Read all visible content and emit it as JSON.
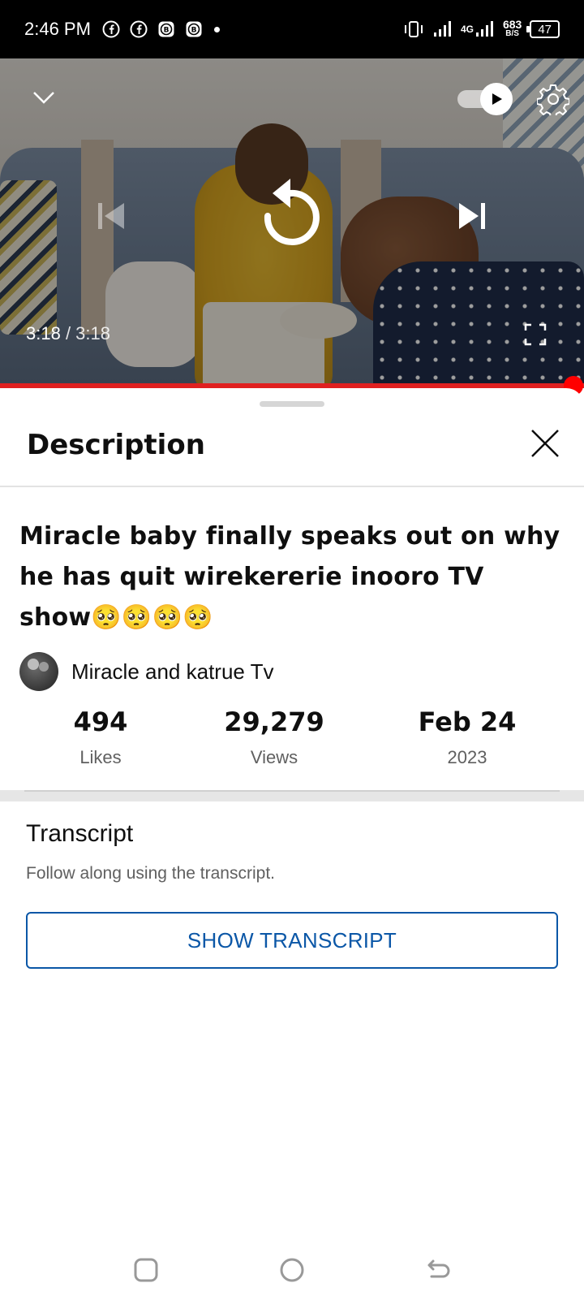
{
  "status_bar": {
    "time": "2:46 PM",
    "network_type": "4G",
    "net_speed_value": "683",
    "net_speed_unit": "B/S",
    "battery": "47",
    "app_icons": [
      "facebook-icon",
      "facebook-icon",
      "bitcoin-icon",
      "bitcoin-icon"
    ]
  },
  "player": {
    "current_time": "3:18",
    "separator": " / ",
    "total_time": "3:18",
    "progress": 1.0
  },
  "description": {
    "header_title": "Description",
    "video_title": "Miracle baby finally speaks out on why he has quit wirekererie inooro TV show🥺🥺🥺🥺",
    "channel_name": "Miracle and katrue Tv",
    "stats": {
      "likes_value": "494",
      "likes_label": "Likes",
      "views_value": "29,279",
      "views_label": "Views",
      "date_value": "Feb 24",
      "date_year": "2023"
    }
  },
  "transcript": {
    "title": "Transcript",
    "subtitle": "Follow along using the transcript.",
    "button_label": "SHOW TRANSCRIPT"
  },
  "colors": {
    "accent_blue": "#0b57a7",
    "progress_red": "#ff0000"
  }
}
